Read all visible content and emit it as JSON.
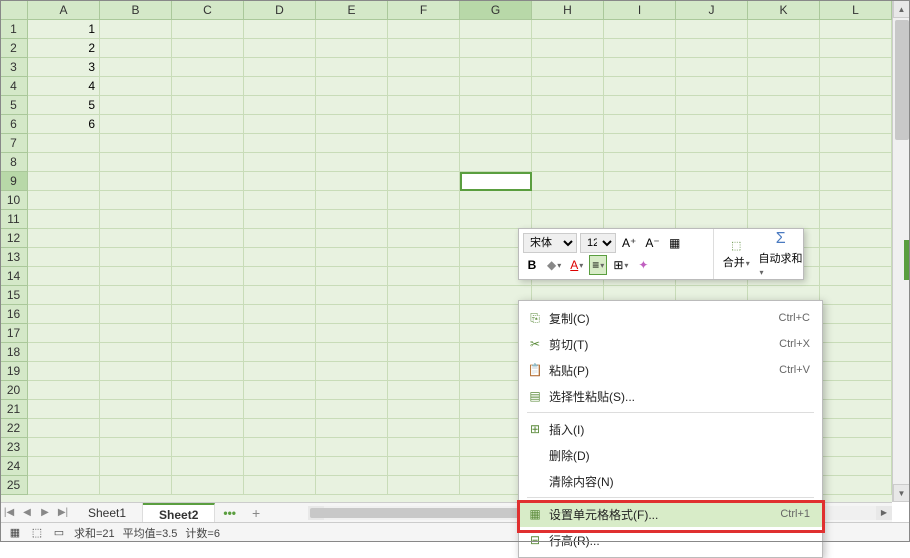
{
  "columns": [
    "A",
    "B",
    "C",
    "D",
    "E",
    "F",
    "G",
    "H",
    "I",
    "J",
    "K",
    "L"
  ],
  "rows": [
    1,
    2,
    3,
    4,
    5,
    6,
    7,
    8,
    9,
    10,
    11,
    12,
    13,
    14,
    15,
    16,
    17,
    18,
    19,
    20,
    21,
    22,
    23,
    24,
    25
  ],
  "dataA": [
    "1",
    "2",
    "3",
    "4",
    "5",
    "6"
  ],
  "activeCell": {
    "row": 9,
    "col": "G"
  },
  "tabs": {
    "nav_first": "|◀",
    "nav_prev": "◀",
    "nav_next": "▶",
    "nav_last": "▶|",
    "sheet1": "Sheet1",
    "sheet2": "Sheet2",
    "more": "•••",
    "add": "+"
  },
  "status": {
    "sum": "求和=21",
    "avg": "平均值=3.5",
    "count": "计数=6"
  },
  "miniToolbar": {
    "font": "宋体",
    "size": "12",
    "increaseFont": "A⁺",
    "decreaseFont": "A⁻",
    "bold": "B",
    "merge": "合并",
    "autosum": "自动求和"
  },
  "contextMenu": {
    "copy": {
      "label": "复制(C)",
      "shortcut": "Ctrl+C"
    },
    "cut": {
      "label": "剪切(T)",
      "shortcut": "Ctrl+X"
    },
    "paste": {
      "label": "粘贴(P)",
      "shortcut": "Ctrl+V"
    },
    "pasteSpecial": {
      "label": "选择性粘贴(S)...",
      "shortcut": ""
    },
    "insert": {
      "label": "插入(I)",
      "shortcut": ""
    },
    "delete": {
      "label": "删除(D)",
      "shortcut": ""
    },
    "clear": {
      "label": "清除内容(N)",
      "shortcut": ""
    },
    "formatCells": {
      "label": "设置单元格格式(F)...",
      "shortcut": "Ctrl+1"
    },
    "rowHeight": {
      "label": "行高(R)...",
      "shortcut": ""
    }
  }
}
